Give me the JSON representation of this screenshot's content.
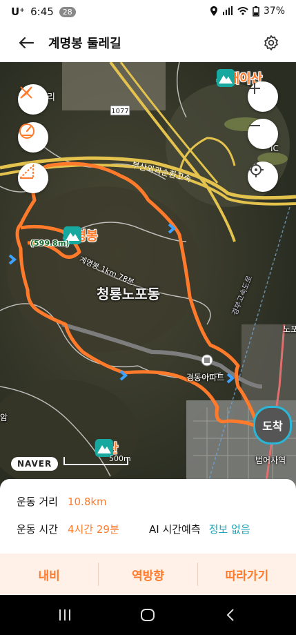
{
  "status": {
    "carrier": "U⁺",
    "time": "6:45",
    "notif_count": "28",
    "battery": "37%"
  },
  "appbar": {
    "title": "계명봉 둘레길"
  },
  "map": {
    "peaks": {
      "main": "계명봉",
      "north": "사배이산",
      "south": "남산"
    },
    "labels": {
      "area": "청룡노포동",
      "highway": "부산외곽순환고속",
      "road_no": "1077",
      "apartment": "경동아파트",
      "elevation": "(599.8m)",
      "station": "범어사역",
      "left_edge": "리",
      "left_edge2": "암",
      "right_edge": "노포",
      "ic": "IC",
      "trail": "계명봉 1km 78분",
      "railway": "경부고속도로"
    },
    "naver_logo": "NAVER",
    "scale": "500m",
    "arrival_marker": "도착",
    "route_color": "#ff7a2a"
  },
  "stats": {
    "distance_label": "운동 거리",
    "distance_value": "10.8km",
    "time_label": "운동 시간",
    "time_value": "4시간 29분",
    "ai_label": "AI 시간예측",
    "ai_value": "정보 없음"
  },
  "actions": {
    "navi": "내비",
    "reverse": "역방향",
    "follow": "따라가기"
  }
}
